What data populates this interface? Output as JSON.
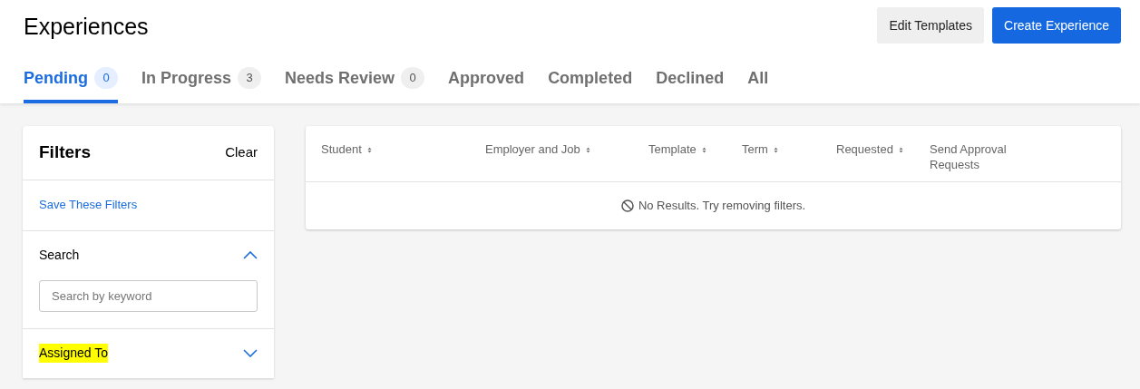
{
  "page_title": "Experiences",
  "buttons": [
    {
      "label": "Edit Templates",
      "kind": "secondary"
    },
    {
      "label": "Create Experience",
      "kind": "primary"
    }
  ],
  "tabs": [
    {
      "label": "Pending",
      "count": "0",
      "selected": true
    },
    {
      "label": "In Progress",
      "count": "3",
      "selected": false
    },
    {
      "label": "Needs Review",
      "count": "0",
      "selected": false
    },
    {
      "label": "Approved",
      "selected": false
    },
    {
      "label": "Completed",
      "selected": false
    },
    {
      "label": "Declined",
      "selected": false
    },
    {
      "label": "All",
      "selected": false
    }
  ],
  "filters": {
    "title": "Filters",
    "clear": "Clear",
    "save_link": "Save These Filters",
    "sections": [
      {
        "label": "Search",
        "expanded": true,
        "highlighted": false,
        "placeholder": "Search by keyword"
      },
      {
        "label": "Assigned To",
        "expanded": false,
        "highlighted": true
      }
    ]
  },
  "table": {
    "columns": [
      {
        "label": "Student",
        "sortable": true
      },
      {
        "label": "Employer and Job",
        "sortable": true
      },
      {
        "label": "Template",
        "sortable": true
      },
      {
        "label": "Term",
        "sortable": true
      },
      {
        "label": "Requested",
        "sortable": true
      },
      {
        "label": "Send Approval Requests",
        "sortable": false
      }
    ],
    "empty_message": "No Results. Try removing filters."
  }
}
